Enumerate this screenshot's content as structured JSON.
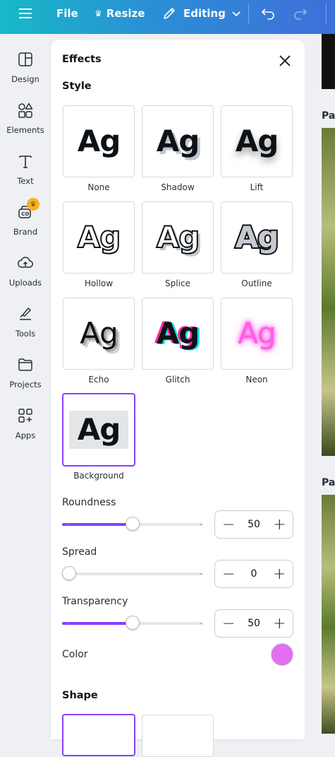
{
  "topbar": {
    "file_label": "File",
    "resize_label": "Resize",
    "editing_label": "Editing"
  },
  "sidebar": {
    "items": [
      {
        "label": "Design",
        "icon": "design-icon"
      },
      {
        "label": "Elements",
        "icon": "elements-icon"
      },
      {
        "label": "Text",
        "icon": "text-icon"
      },
      {
        "label": "Brand",
        "icon": "brand-icon"
      },
      {
        "label": "Uploads",
        "icon": "uploads-icon"
      },
      {
        "label": "Tools",
        "icon": "tools-icon"
      },
      {
        "label": "Projects",
        "icon": "projects-icon"
      },
      {
        "label": "Apps",
        "icon": "apps-icon"
      }
    ]
  },
  "panel": {
    "title": "Effects",
    "style_title": "Style",
    "preview_text": "Ag",
    "styles": [
      {
        "label": "None"
      },
      {
        "label": "Shadow"
      },
      {
        "label": "Lift"
      },
      {
        "label": "Hollow"
      },
      {
        "label": "Splice"
      },
      {
        "label": "Outline"
      },
      {
        "label": "Echo"
      },
      {
        "label": "Glitch"
      },
      {
        "label": "Neon"
      },
      {
        "label": "Background"
      }
    ],
    "selected_style": "Background",
    "controls": {
      "roundness": {
        "label": "Roundness",
        "value": "50",
        "fraction": 0.5
      },
      "spread": {
        "label": "Spread",
        "value": "0",
        "fraction": 0
      },
      "transparency": {
        "label": "Transparency",
        "value": "50",
        "fraction": 0.5
      }
    },
    "color_label": "Color",
    "color_value": "#e26ef0",
    "shape_title": "Shape"
  },
  "canvas": {
    "page_label_short": "Pag"
  },
  "colors": {
    "accent": "#8b3dff"
  }
}
